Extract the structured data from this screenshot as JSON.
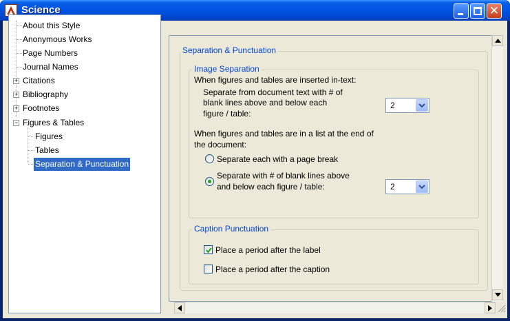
{
  "window": {
    "title": "Science",
    "minimize_label": "",
    "maximize_label": "",
    "close_label": "✕"
  },
  "tree": {
    "items": [
      {
        "label": "About this Style",
        "level": 0,
        "expander": null,
        "selected": false
      },
      {
        "label": "Anonymous Works",
        "level": 0,
        "expander": null,
        "selected": false
      },
      {
        "label": "Page Numbers",
        "level": 0,
        "expander": null,
        "selected": false
      },
      {
        "label": "Journal Names",
        "level": 0,
        "expander": null,
        "selected": false
      },
      {
        "label": "Citations",
        "level": 0,
        "expander": "+",
        "selected": false
      },
      {
        "label": "Bibliography",
        "level": 0,
        "expander": "+",
        "selected": false
      },
      {
        "label": "Footnotes",
        "level": 0,
        "expander": "+",
        "selected": false
      },
      {
        "label": "Figures & Tables",
        "level": 0,
        "expander": "−",
        "selected": false
      },
      {
        "label": "Figures",
        "level": 1,
        "expander": null,
        "selected": false
      },
      {
        "label": "Tables",
        "level": 1,
        "expander": null,
        "selected": false
      },
      {
        "label": "Separation & Punctuation",
        "level": 1,
        "expander": null,
        "selected": true
      }
    ]
  },
  "panel": {
    "section_title": "Separation & Punctuation",
    "image_separation": {
      "title": "Image Separation",
      "intext_heading": "When figures and tables are inserted in-text:",
      "intext_line1": "Separate from document text with # of",
      "intext_line2": "blank lines above and below each",
      "intext_line3": "figure / table:",
      "intext_value": "2",
      "list_heading_line1": "When figures and tables are in a list at the end of",
      "list_heading_line2": "the document:",
      "radio_page_break": "Separate each with a page break",
      "radio_blank_lines_line1": "Separate with # of blank lines above",
      "radio_blank_lines_line2": "and below each figure / table:",
      "list_value": "2",
      "selected_option": "blank_lines"
    },
    "caption_punctuation": {
      "title": "Caption Punctuation",
      "period_after_label": "Place a period after the label",
      "period_after_label_checked": true,
      "period_after_caption": "Place a period after the caption",
      "period_after_caption_checked": false
    }
  },
  "colors": {
    "title_bar": "#0054e3",
    "group_title": "#0046d5",
    "selection": "#316ac5",
    "background": "#ece9d8"
  }
}
